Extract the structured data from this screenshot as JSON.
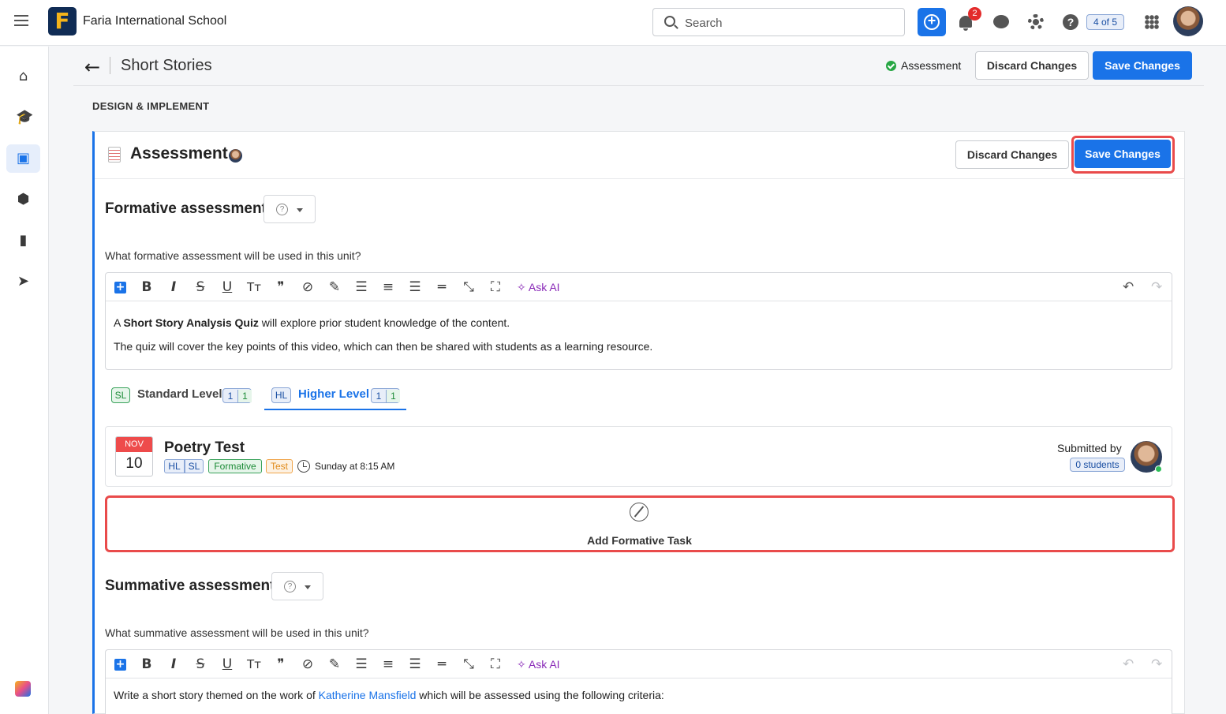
{
  "topbar": {
    "school_name": "Faria International School",
    "logo_letter": "F",
    "search_placeholder": "Search",
    "notification_count": "2",
    "progress_text": "4 of 5",
    "help_glyph": "?",
    "plus_glyph": "+"
  },
  "sidebar": {
    "items": [
      {
        "icon": "home-icon",
        "glyph": "⌂"
      },
      {
        "icon": "graduation-cap-icon",
        "glyph": "🎓"
      },
      {
        "icon": "book-icon",
        "glyph": "▣"
      },
      {
        "icon": "cube-icon",
        "glyph": "⬢"
      },
      {
        "icon": "bar-chart-icon",
        "glyph": "▮"
      },
      {
        "icon": "compass-icon",
        "glyph": "➤"
      }
    ],
    "active_index": 2
  },
  "page": {
    "back_glyph": "←",
    "title": "Short Stories",
    "status_label": "Assessment",
    "discard_label": "Discard Changes",
    "save_label": "Save Changes",
    "section_label": "DESIGN & IMPLEMENT"
  },
  "panel": {
    "title": "Assessment",
    "discard_label": "Discard Changes",
    "save_label": "Save Changes"
  },
  "formative": {
    "heading": "Formative assessment",
    "question": "What formative assessment will be used in this unit?",
    "ask_ai": "Ask AI",
    "line1_pre": "A ",
    "line1_bold": "Short Story Analysis Quiz",
    "line1_post": " will explore prior student knowledge of the content.",
    "line2": "The quiz will cover the key points of this video, which can then be shared with students as a learning resource."
  },
  "levels": [
    {
      "abbr": "SL",
      "label": "Standard Level",
      "count_a": "1",
      "count_b": "1"
    },
    {
      "abbr": "HL",
      "label": "Higher Level",
      "count_a": "1",
      "count_b": "1"
    }
  ],
  "task": {
    "month": "NOV",
    "day": "10",
    "title": "Poetry Test",
    "tags": [
      "HL",
      "SL",
      "Formative",
      "Test"
    ],
    "time": "Sunday at 8:15 AM",
    "submitted_label": "Submitted by",
    "students": "0 students"
  },
  "add_task_label": "Add Formative Task",
  "summative": {
    "heading": "Summative assessment",
    "question": "What summative assessment will be used in this unit?",
    "ask_ai": "Ask AI",
    "line1_pre": "Write a short story themed on the work of ",
    "line1_link": "Katherine Mansfield",
    "line1_post": " which will be assessed using the following criteria:"
  },
  "toolbar_glyphs": {
    "bold": "B",
    "italic": "I",
    "strike": "S",
    "underline": "U",
    "text_size": "Tт",
    "quote": "❞",
    "link": "⊘",
    "highlight": "✎",
    "bullets": "☰",
    "numbers": "≡",
    "align": "☰",
    "hr": "═",
    "clear": "⤡",
    "fullscreen": "⛶",
    "ai": "✧",
    "undo": "↶",
    "redo": "↷"
  },
  "colors": {
    "accent": "#1a73e8",
    "highlight_border": "#e94b4b",
    "status_green": "#28a745",
    "ai_purple": "#8a2bb8"
  }
}
